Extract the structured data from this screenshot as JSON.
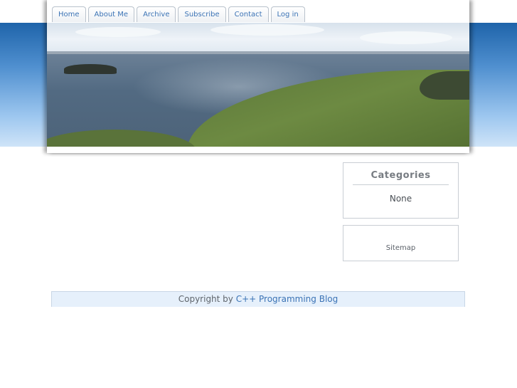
{
  "nav": {
    "tabs": [
      {
        "label": "Home"
      },
      {
        "label": "About Me"
      },
      {
        "label": "Archive"
      },
      {
        "label": "Subscribe"
      },
      {
        "label": "Contact"
      },
      {
        "label": "Log in"
      }
    ]
  },
  "sidebar": {
    "categories": {
      "title": "Categories",
      "value": "None"
    },
    "sitemap_label": "Sitemap"
  },
  "footer": {
    "prefix": "Copyright by ",
    "site_link": "C++ Programming Blog"
  },
  "colors": {
    "link": "#3b73b5",
    "band_top": "#1f64aa",
    "band_bottom": "#cfe4f8",
    "footer_bg": "#e6f0fb"
  }
}
